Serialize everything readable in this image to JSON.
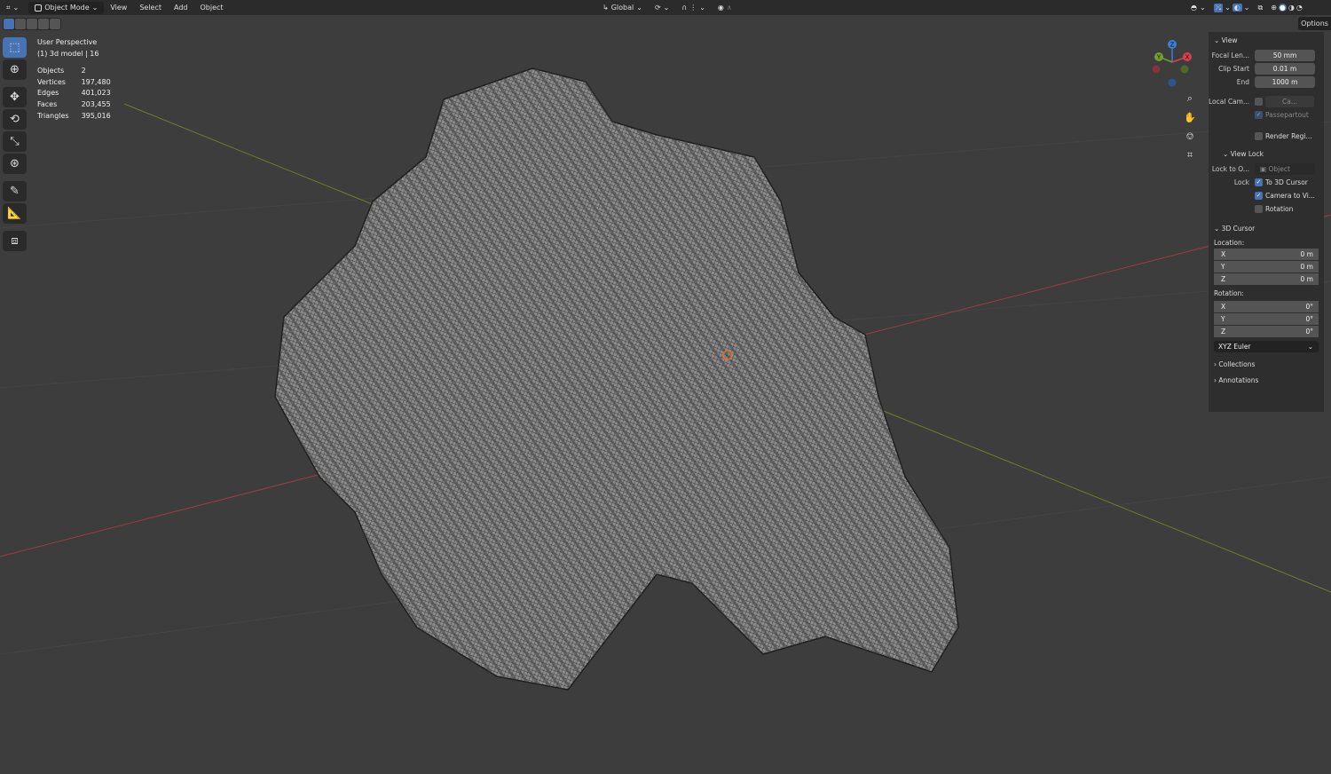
{
  "header": {
    "editor_icon": "viewport-icon",
    "mode": "Object Mode",
    "menus": [
      "View",
      "Select",
      "Add",
      "Object"
    ],
    "transform_orientation": "Global"
  },
  "overlay": {
    "view_name": "User Perspective",
    "collection": "(1) 3d model | 16",
    "stats": [
      {
        "label": "Objects",
        "value": "2"
      },
      {
        "label": "Vertices",
        "value": "197,480"
      },
      {
        "label": "Edges",
        "value": "401,023"
      },
      {
        "label": "Faces",
        "value": "203,455"
      },
      {
        "label": "Triangles",
        "value": "395,016"
      }
    ]
  },
  "gizmo": {
    "x": "X",
    "y": "Y",
    "z": "Z"
  },
  "options_label": "Options",
  "npanel": {
    "view": {
      "title": "View",
      "focal_label": "Focal Len...",
      "focal": "50 mm",
      "clip_start_label": "Clip Start",
      "clip_start": "0.01 m",
      "end_label": "End",
      "end": "1000 m",
      "local_cam_label": "Local Cam...",
      "local_cam_value": "Ca...",
      "passepartout": "Passepartout",
      "render_region": "Render Regi..."
    },
    "view_lock": {
      "title": "View Lock",
      "lock_to_label": "Lock to O...",
      "lock_to_placeholder": "Object",
      "lock_label": "Lock",
      "to_cursor": "To 3D Cursor",
      "camera_to_view": "Camera to Vi...",
      "rotation": "Rotation"
    },
    "cursor": {
      "title": "3D Cursor",
      "location_label": "Location:",
      "loc": [
        {
          "axis": "X",
          "value": "0 m"
        },
        {
          "axis": "Y",
          "value": "0 m"
        },
        {
          "axis": "Z",
          "value": "0 m"
        }
      ],
      "rotation_label": "Rotation:",
      "rot": [
        {
          "axis": "X",
          "value": "0°"
        },
        {
          "axis": "Y",
          "value": "0°"
        },
        {
          "axis": "Z",
          "value": "0°"
        }
      ],
      "rotation_mode": "XYZ Euler"
    },
    "collections": "Collections",
    "annotations": "Annotations"
  },
  "colors": {
    "accent": "#4772b3",
    "viewport": "#3d3d3d",
    "x_axis": "#b8404a",
    "y_axis": "#7d9a2c"
  }
}
